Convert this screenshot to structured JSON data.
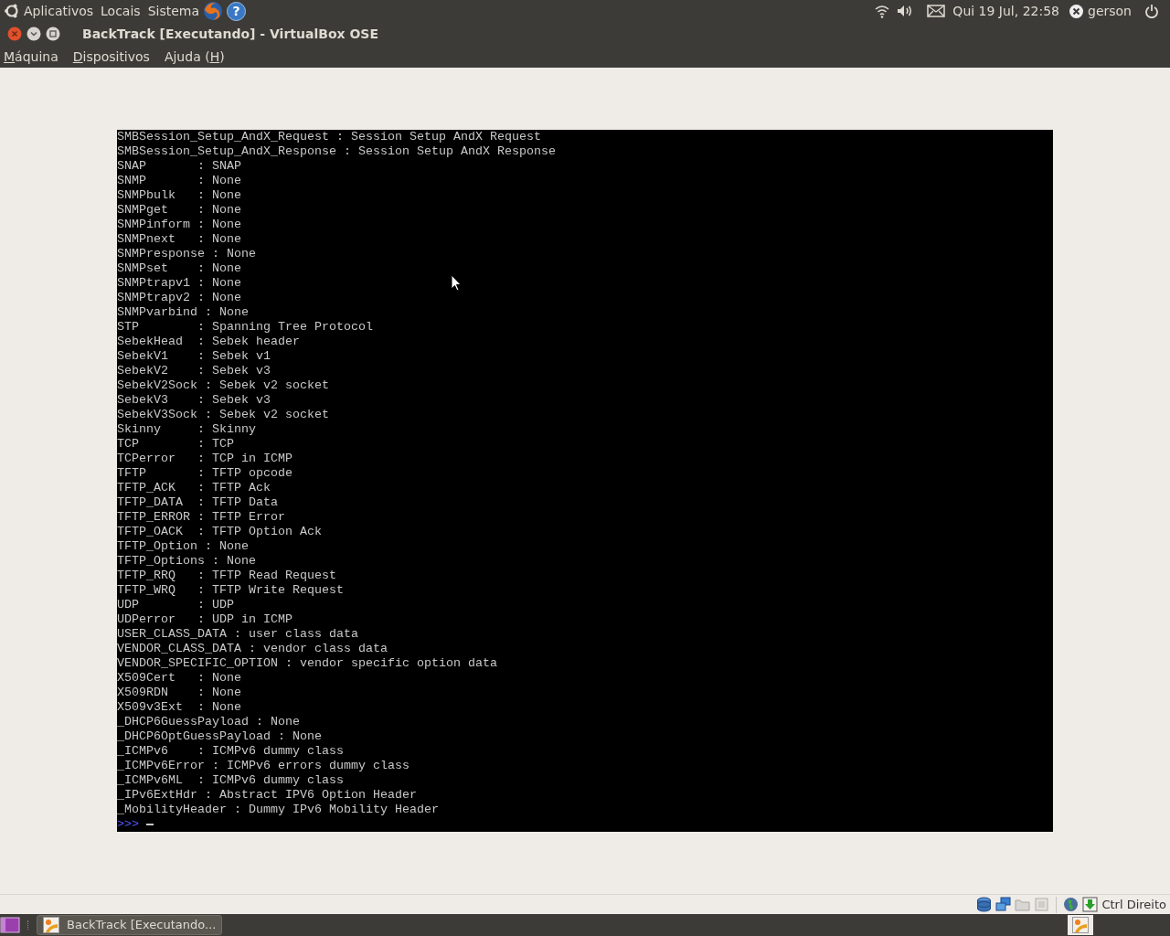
{
  "top_panel": {
    "menus": [
      "Aplicativos",
      "Locais",
      "Sistema"
    ],
    "help_glyph": "?",
    "clock": "Qui 19 Jul, 22:58",
    "user": "gerson"
  },
  "window": {
    "title": "BackTrack [Executando] - VirtualBox OSE",
    "menu": [
      {
        "key": "M",
        "after": "áquina"
      },
      {
        "key": "D",
        "after": "ispositivos"
      },
      {
        "before": "Ajuda (",
        "key": "H",
        "after": ")"
      }
    ]
  },
  "console": {
    "lines": [
      "SMBSession_Setup_AndX_Request : Session Setup AndX Request",
      "SMBSession_Setup_AndX_Response : Session Setup AndX Response",
      "SNAP       : SNAP",
      "SNMP       : None",
      "SNMPbulk   : None",
      "SNMPget    : None",
      "SNMPinform : None",
      "SNMPnext   : None",
      "SNMPresponse : None",
      "SNMPset    : None",
      "SNMPtrapv1 : None",
      "SNMPtrapv2 : None",
      "SNMPvarbind : None",
      "STP        : Spanning Tree Protocol",
      "SebekHead  : Sebek header",
      "SebekV1    : Sebek v1",
      "SebekV2    : Sebek v3",
      "SebekV2Sock : Sebek v2 socket",
      "SebekV3    : Sebek v3",
      "SebekV3Sock : Sebek v2 socket",
      "Skinny     : Skinny",
      "TCP        : TCP",
      "TCPerror   : TCP in ICMP",
      "TFTP       : TFTP opcode",
      "TFTP_ACK   : TFTP Ack",
      "TFTP_DATA  : TFTP Data",
      "TFTP_ERROR : TFTP Error",
      "TFTP_OACK  : TFTP Option Ack",
      "TFTP_Option : None",
      "TFTP_Options : None",
      "TFTP_RRQ   : TFTP Read Request",
      "TFTP_WRQ   : TFTP Write Request",
      "UDP        : UDP",
      "UDPerror   : UDP in ICMP",
      "USER_CLASS_DATA : user class data",
      "VENDOR_CLASS_DATA : vendor class data",
      "VENDOR_SPECIFIC_OPTION : vendor specific option data",
      "X509Cert   : None",
      "X509RDN    : None",
      "X509v3Ext  : None",
      "_DHCP6GuessPayload : None",
      "_DHCP6OptGuessPayload : None",
      "_ICMPv6    : ICMPv6 dummy class",
      "_ICMPv6Error : ICMPv6 errors dummy class",
      "_ICMPv6ML  : ICMPv6 dummy class",
      "_IPv6ExtHdr : Abstract IPV6 Option Header",
      "_MobilityHeader : Dummy IPv6 Mobility Header"
    ],
    "prompt": ">>>"
  },
  "status_bar": {
    "host_key": "Ctrl Direito"
  },
  "taskbar": {
    "tasks": [
      {
        "label": "BackTrack [Executando...",
        "selected": true
      }
    ]
  }
}
